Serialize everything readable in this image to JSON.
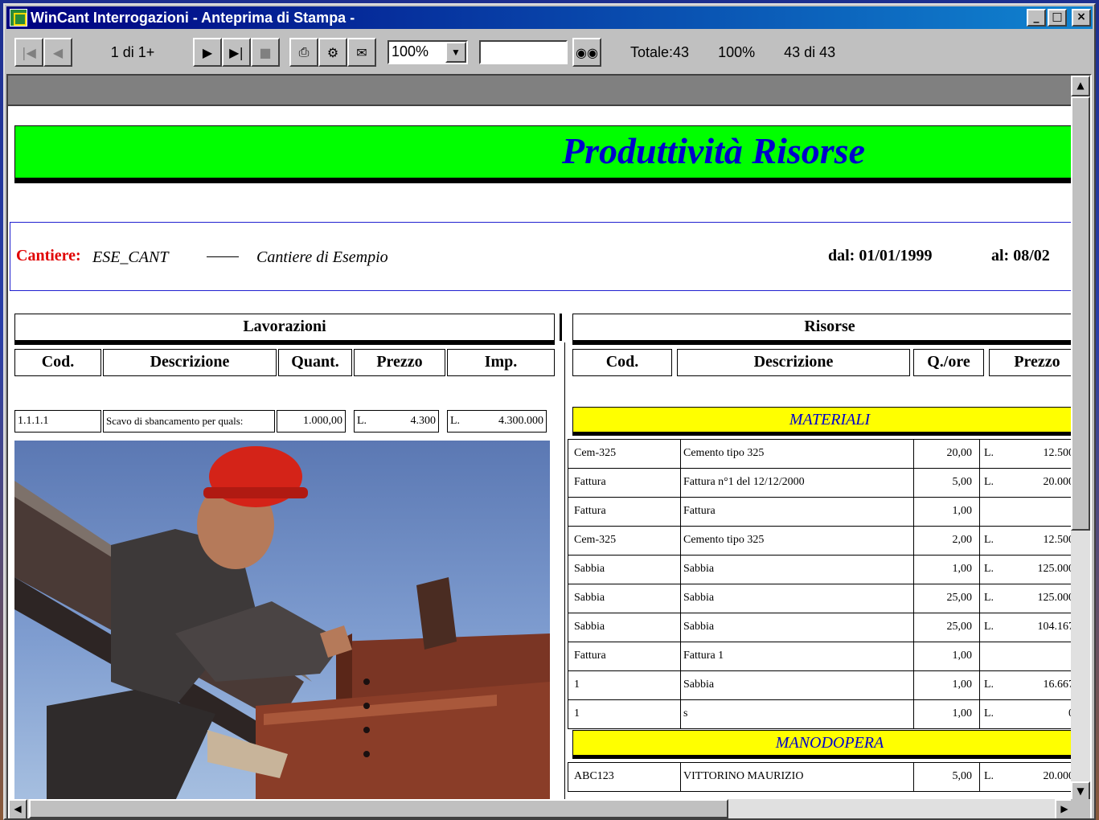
{
  "window": {
    "title": "WinCant Interrogazioni - Anteprima di Stampa -",
    "buttons": {
      "minimize": "_",
      "maximize": "□",
      "close": "×"
    }
  },
  "toolbar": {
    "page_label": "1 di 1+",
    "zoom": "100%",
    "search_value": "",
    "total": "Totale:43",
    "percent": "100%",
    "records": "43 di 43"
  },
  "report": {
    "title": "Produttività  Risorse",
    "cantiere_label": "Cantiere:",
    "cantiere_code": "ESE_CANT",
    "cantiere_desc": "Cantiere di Esempio",
    "date_from": "dal:  01/01/1999",
    "date_to": "al:  08/02",
    "lavorazioni": {
      "heading": "Lavorazioni",
      "columns": [
        "Cod.",
        "Descrizione",
        "Quant.",
        "Prezzo",
        "Imp."
      ],
      "row": {
        "cod": "1.1.1.1",
        "desc": "Scavo di sbancamento per quals:",
        "quant": "1.000,00",
        "prezzo_cur": "L.",
        "prezzo": "4.300",
        "imp_cur": "L.",
        "imp": "4.300.000"
      }
    },
    "risorse": {
      "heading": "Risorse",
      "columns": [
        "Cod.",
        "Descrizione",
        "Q./ore",
        "Prezzo"
      ],
      "cat_materiali": "MATERIALI",
      "cat_manodopera": "MANODOPERA",
      "materiali": [
        {
          "cod": "Cem-325",
          "desc": "Cemento tipo 325",
          "q": "20,00",
          "cur": "L.",
          "prezzo": "12.500"
        },
        {
          "cod": "Fattura",
          "desc": "Fattura n°1 del 12/12/2000",
          "q": "5,00",
          "cur": "L.",
          "prezzo": "20.000"
        },
        {
          "cod": "Fattura",
          "desc": "Fattura",
          "q": "1,00",
          "cur": "",
          "prezzo": ""
        },
        {
          "cod": "Cem-325",
          "desc": "Cemento tipo 325",
          "q": "2,00",
          "cur": "L.",
          "prezzo": "12.500"
        },
        {
          "cod": "Sabbia",
          "desc": "Sabbia",
          "q": "1,00",
          "cur": "L.",
          "prezzo": "125.000"
        },
        {
          "cod": "Sabbia",
          "desc": "Sabbia",
          "q": "25,00",
          "cur": "L.",
          "prezzo": "125.000"
        },
        {
          "cod": "Sabbia",
          "desc": "Sabbia",
          "q": "25,00",
          "cur": "L.",
          "prezzo": "104.167"
        },
        {
          "cod": "Fattura",
          "desc": "Fattura 1",
          "q": "1,00",
          "cur": "",
          "prezzo": ""
        },
        {
          "cod": "1",
          "desc": "Sabbia",
          "q": "1,00",
          "cur": "L.",
          "prezzo": "16.667"
        },
        {
          "cod": "1",
          "desc": "s",
          "q": "1,00",
          "cur": "L.",
          "prezzo": "0"
        }
      ],
      "manodopera": [
        {
          "cod": "ABC123",
          "desc": "VITTORINO MAURIZIO",
          "q": "5,00",
          "cur": "L.",
          "prezzo": "20.000"
        }
      ]
    }
  },
  "colors": {
    "banner_green": "#00ff00",
    "banner_text": "#0000cc",
    "category_yellow": "#ffff00",
    "cantiere_red": "#e00000"
  }
}
